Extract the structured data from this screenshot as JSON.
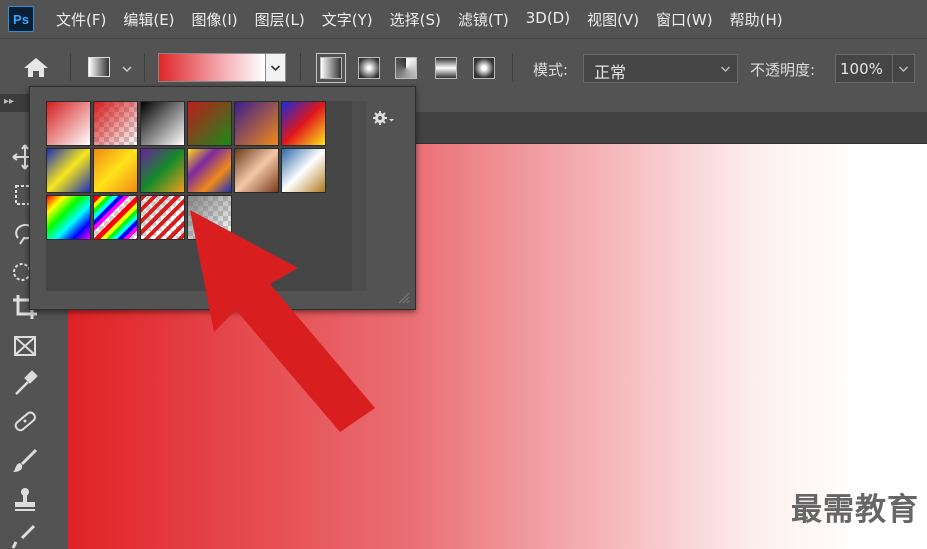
{
  "app": {
    "logo_text": "Ps"
  },
  "menu": {
    "items": [
      {
        "label": "文件(F)"
      },
      {
        "label": "编辑(E)"
      },
      {
        "label": "图像(I)"
      },
      {
        "label": "图层(L)"
      },
      {
        "label": "文字(Y)"
      },
      {
        "label": "选择(S)"
      },
      {
        "label": "滤镜(T)"
      },
      {
        "label": "3D(D)"
      },
      {
        "label": "视图(V)"
      },
      {
        "label": "窗口(W)"
      },
      {
        "label": "帮助(H)"
      }
    ]
  },
  "options": {
    "mode_label": "模式:",
    "mode_value": "正常",
    "opacity_label": "不透明度:",
    "opacity_value": "100%",
    "gradient_types": [
      "linear",
      "radial",
      "angle",
      "reflected",
      "diamond"
    ],
    "active_gradient_type": "linear",
    "current_gradient": {
      "from": "#e02628",
      "to": "#ffffff"
    }
  },
  "tools": [
    "move-icon",
    "marquee-icon",
    "lasso-icon",
    "quick-select-icon",
    "crop-icon",
    "frame-icon",
    "eyedropper-icon",
    "healing-brush-icon",
    "brush-icon",
    "clone-stamp-icon",
    "history-brush-icon"
  ],
  "gradient_picker": {
    "presets": [
      {
        "name": "foreground-to-background",
        "colors": [
          "#d41e1e",
          "#ffffff"
        ]
      },
      {
        "name": "foreground-to-transparent",
        "colors": [
          "#d41e1e",
          "transparent"
        ]
      },
      {
        "name": "black-white",
        "colors": [
          "#000000",
          "#ffffff"
        ]
      },
      {
        "name": "red-green",
        "colors": [
          "#c01c1c",
          "#1a8a1a"
        ]
      },
      {
        "name": "violet-orange",
        "colors": [
          "#3b1f8c",
          "#f08a1a"
        ]
      },
      {
        "name": "blue-red-yellow",
        "colors": [
          "#1a2bd8",
          "#e0161c",
          "#ffe81a"
        ]
      },
      {
        "name": "blue-yellow-blue",
        "colors": [
          "#1a2fb8",
          "#f7e71c",
          "#1a2fb8"
        ]
      },
      {
        "name": "orange-yellow-orange",
        "colors": [
          "#f08a14",
          "#ffe21a",
          "#f08a14"
        ]
      },
      {
        "name": "violet-green-orange",
        "colors": [
          "#6d1fa0",
          "#168a2a",
          "#f0a01a"
        ]
      },
      {
        "name": "yellow-violet-orange-blue",
        "colors": [
          "#ffd81a",
          "#7a2aa0",
          "#f08a1a",
          "#1a2fb8"
        ]
      },
      {
        "name": "copper",
        "colors": [
          "#6a3a1a",
          "#f2c8a8",
          "#7a3a1a"
        ]
      },
      {
        "name": "chrome",
        "colors": [
          "#2a6aa8",
          "#ffffff",
          "#b07a1a"
        ]
      },
      {
        "name": "spectrum",
        "colors": [
          "#ff0000",
          "#ffff00",
          "#00ff00",
          "#00ffff",
          "#0000ff",
          "#ff00ff"
        ]
      },
      {
        "name": "transparent-rainbow",
        "colors": [
          "#ff0000",
          "#ffff00",
          "#00ff00",
          "#00ffff",
          "#0000ff",
          "#ff00ff"
        ]
      },
      {
        "name": "transparent-stripes",
        "colors": [
          "#d41e1e",
          "transparent"
        ]
      },
      {
        "name": "neutral-density",
        "colors": [
          "#9a9a9a",
          "transparent"
        ]
      }
    ]
  },
  "annotation": {
    "arrow_color": "#d81e1e"
  },
  "watermark": "最需教育"
}
